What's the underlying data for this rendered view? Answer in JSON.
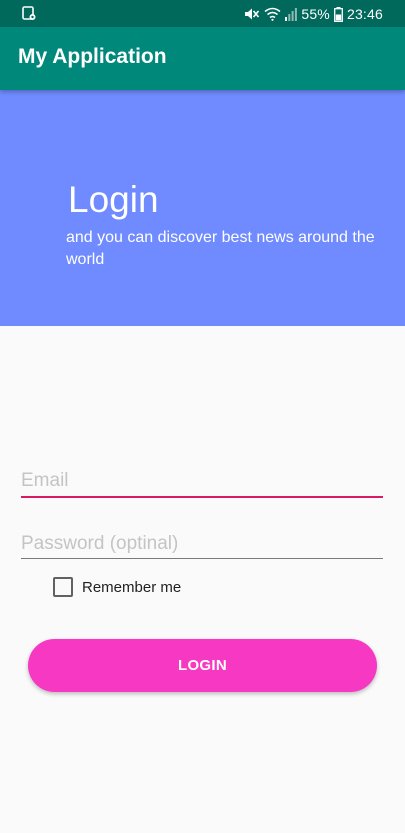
{
  "status_bar": {
    "battery_percent": "55%",
    "time": "23:46",
    "icons": [
      "notification-icon",
      "mute-icon",
      "wifi-icon",
      "signal-icon",
      "battery-icon"
    ]
  },
  "app_bar": {
    "title": "My Application"
  },
  "hero": {
    "title": "Login",
    "subtitle": "and you can discover best news around the world"
  },
  "form": {
    "email_placeholder": "Email",
    "email_value": "",
    "password_placeholder": "Password (optinal)",
    "password_value": "",
    "remember_label": "Remember me",
    "remember_checked": false,
    "login_label": "LOGIN"
  },
  "colors": {
    "status_bar": "#00695c",
    "app_bar": "#00897b",
    "hero_background": "#6f8bff",
    "email_underline_focused": "#d81b60",
    "login_button": "#f738c2"
  }
}
